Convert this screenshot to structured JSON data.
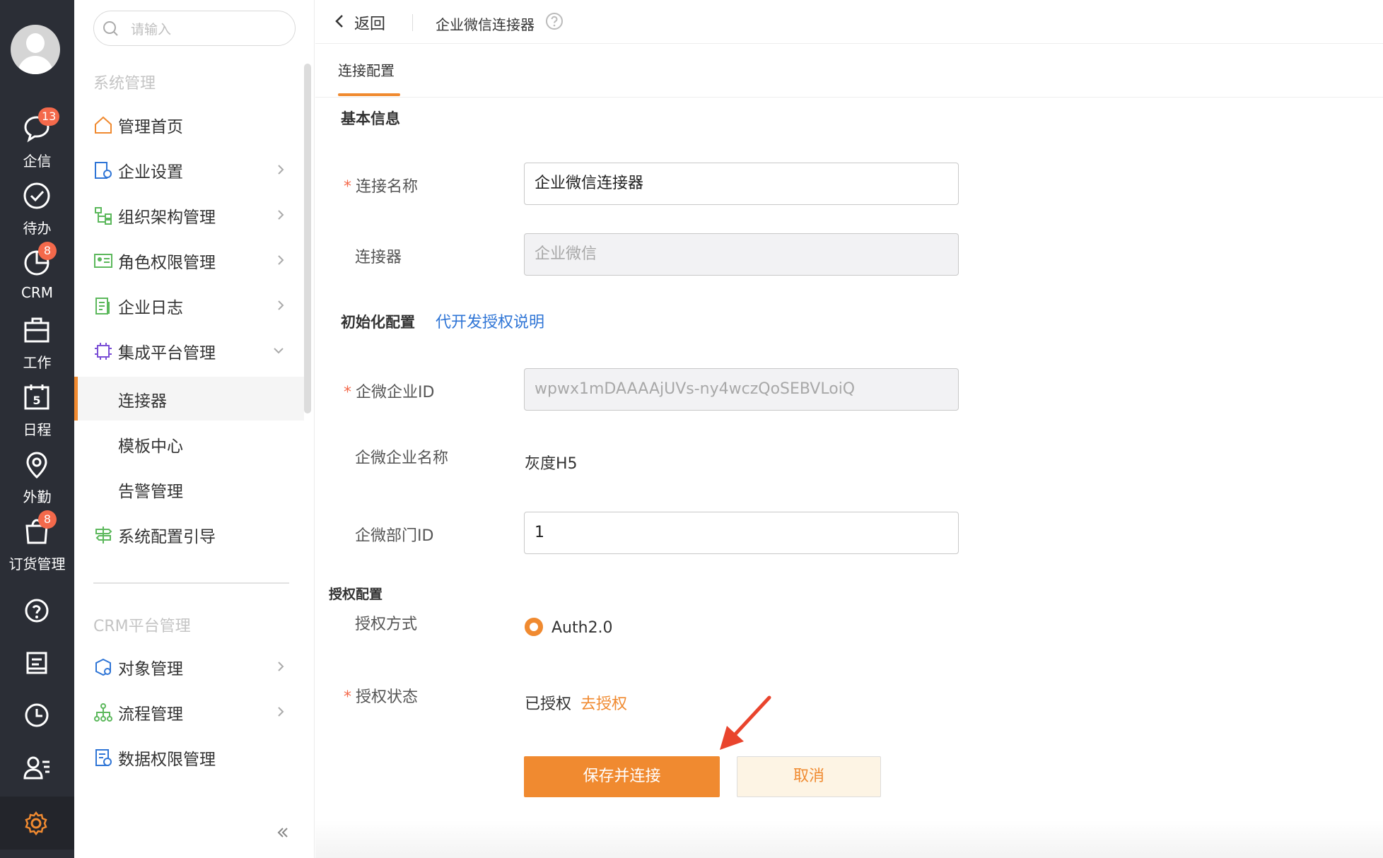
{
  "leftbar": {
    "items": [
      {
        "label": "企信",
        "icon": "chat-icon",
        "badge": "13"
      },
      {
        "label": "待办",
        "icon": "check-circle-icon",
        "badge": ""
      },
      {
        "label": "CRM",
        "icon": "pie-chart-icon",
        "badge": "8"
      },
      {
        "label": "工作",
        "icon": "briefcase-icon",
        "badge": ""
      },
      {
        "label": "日程",
        "icon": "calendar-icon",
        "badge": "",
        "day": "5"
      },
      {
        "label": "外勤",
        "icon": "location-pin-icon",
        "badge": ""
      },
      {
        "label": "订货管理",
        "icon": "shopping-bag-icon",
        "badge": "8"
      }
    ],
    "bottom_icons": [
      "help-icon",
      "notes-icon",
      "clock-icon",
      "contacts-icon",
      "settings-icon"
    ]
  },
  "sidebar": {
    "search_placeholder": "请输入",
    "section1_title": "系统管理",
    "section1_items": [
      {
        "label": "管理首页",
        "icon": "home-icon"
      },
      {
        "label": "企业设置",
        "icon": "enterprise-settings-icon"
      },
      {
        "label": "组织架构管理",
        "icon": "org-structure-icon"
      },
      {
        "label": "角色权限管理",
        "icon": "id-card-icon"
      },
      {
        "label": "企业日志",
        "icon": "log-icon"
      },
      {
        "label": "集成平台管理",
        "icon": "chip-icon"
      }
    ],
    "sub_items": [
      "连接器",
      "模板中心",
      "告警管理"
    ],
    "guide_item": {
      "label": "系统配置引导",
      "icon": "signpost-icon"
    },
    "section2_title": "CRM平台管理",
    "section2_items": [
      {
        "label": "对象管理",
        "icon": "object-cube-icon"
      },
      {
        "label": "流程管理",
        "icon": "flow-icon"
      },
      {
        "label": "数据权限管理",
        "icon": "data-permission-icon"
      }
    ]
  },
  "header": {
    "back_label": "返回",
    "title": "企业微信连接器"
  },
  "tabs": {
    "active": "连接配置"
  },
  "form": {
    "basic_title": "基本信息",
    "name_label": "连接名称",
    "name_value": "企业微信连接器",
    "connector_label": "连接器",
    "connector_value": "企业微信",
    "init_title": "初始化配置",
    "init_link": "代开发授权说明",
    "corp_id_label": "企微企业ID",
    "corp_id_value": "wpwx1mDAAAAjUVs-ny4wczQoSEBVLoiQ",
    "corp_name_label": "企微企业名称",
    "corp_name_value": "灰度H5",
    "dept_id_label": "企微部门ID",
    "dept_id_value": "1",
    "auth_title": "授权配置",
    "auth_method_label": "授权方式",
    "auth_method_value": "Auth2.0",
    "auth_status_label": "授权状态",
    "auth_status_value": "已授权",
    "auth_action": "去授权",
    "save_button": "保存并连接",
    "cancel_button": "取消"
  },
  "colors": {
    "accent": "#f08a30",
    "link": "#2f75d6",
    "leftbar": "#2b2e36",
    "badge": "#f4694b"
  }
}
